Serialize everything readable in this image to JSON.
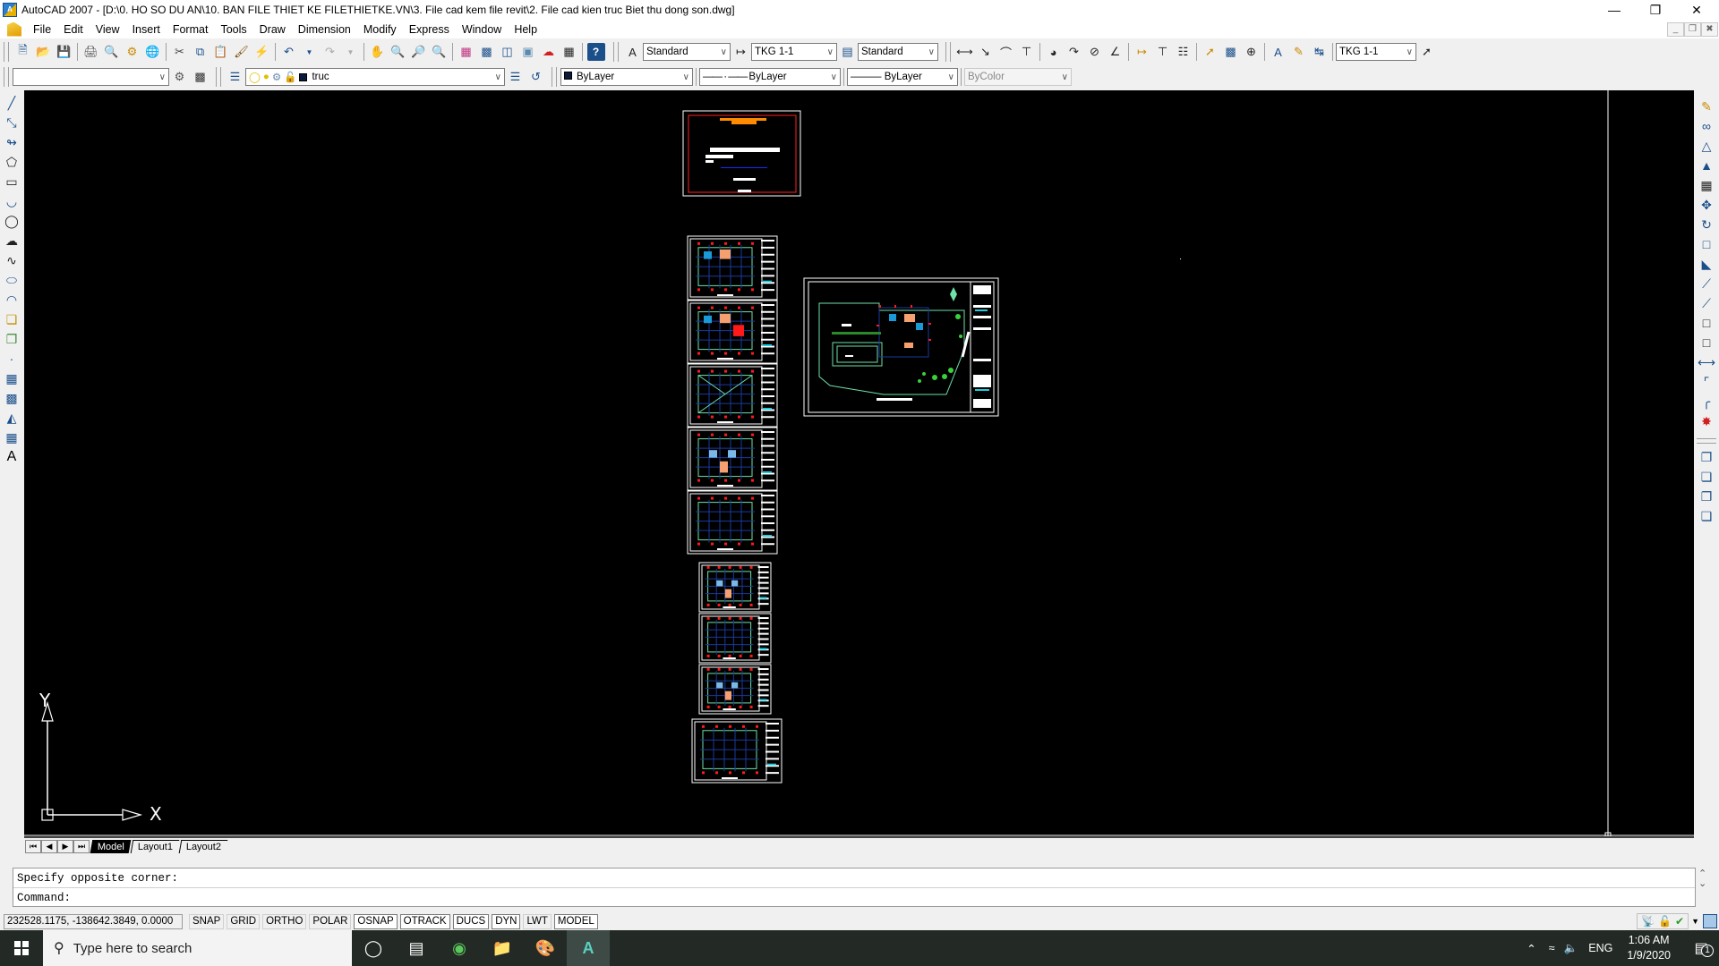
{
  "window": {
    "title": "AutoCAD 2007 - [D:\\0. HO SO DU AN\\10. BAN FILE THIET KE FILETHIETKE.VN\\3. File cad kem file revit\\2. File cad kien truc Biet thu dong son.dwg]",
    "app_icon_label": "A",
    "minimize": "—",
    "restore": "❐",
    "close": "✕",
    "doc_minimize": "_",
    "doc_restore": "❐",
    "doc_close": "✖"
  },
  "menu": {
    "items": [
      "File",
      "Edit",
      "View",
      "Insert",
      "Format",
      "Tools",
      "Draw",
      "Dimension",
      "Modify",
      "Express",
      "Window",
      "Help"
    ]
  },
  "styles_toolbar": {
    "text_style": "Standard",
    "dim_style": "TKG 1-1",
    "table_style": "Standard",
    "dim_style_2": "TKG 1-1"
  },
  "layers_toolbar": {
    "workspace": "",
    "layer": "truc",
    "color": "ByLayer",
    "linetype": "ByLayer",
    "lineweight": "ByLayer",
    "plotstyle": "ByColor"
  },
  "ucs": {
    "x_label": "X",
    "y_label": "Y"
  },
  "layout_tabs": {
    "nav": [
      "⏮",
      "◀",
      "▶",
      "⏭"
    ],
    "tabs": [
      "Model",
      "Layout1",
      "Layout2"
    ],
    "active": "Model"
  },
  "command": {
    "history": "Specify opposite corner:",
    "prompt": "Command:"
  },
  "status": {
    "coordinates": "232528.1175, -138642.3849, 0.0000",
    "toggles": [
      {
        "label": "SNAP",
        "on": false
      },
      {
        "label": "GRID",
        "on": false
      },
      {
        "label": "ORTHO",
        "on": false
      },
      {
        "label": "POLAR",
        "on": false
      },
      {
        "label": "OSNAP",
        "on": true
      },
      {
        "label": "OTRACK",
        "on": true
      },
      {
        "label": "DUCS",
        "on": true
      },
      {
        "label": "DYN",
        "on": true
      },
      {
        "label": "LWT",
        "on": false
      },
      {
        "label": "MODEL",
        "on": true
      }
    ]
  },
  "taskbar": {
    "search_placeholder": "Type here to search",
    "language": "ENG",
    "time": "1:06 AM",
    "date": "1/9/2020",
    "notification_count": "1"
  },
  "colors": {
    "canvas": "#000000",
    "sheet_border": "#ffffff",
    "title_border": "#ff2020",
    "title_orange": "#ff8c00",
    "plan_green": "#6ee0a8",
    "plan_blue": "#1a9bd7",
    "grid_blue": "#1a3a9a",
    "axis_red": "#ff1a1a",
    "taskbar": "#232a26"
  }
}
